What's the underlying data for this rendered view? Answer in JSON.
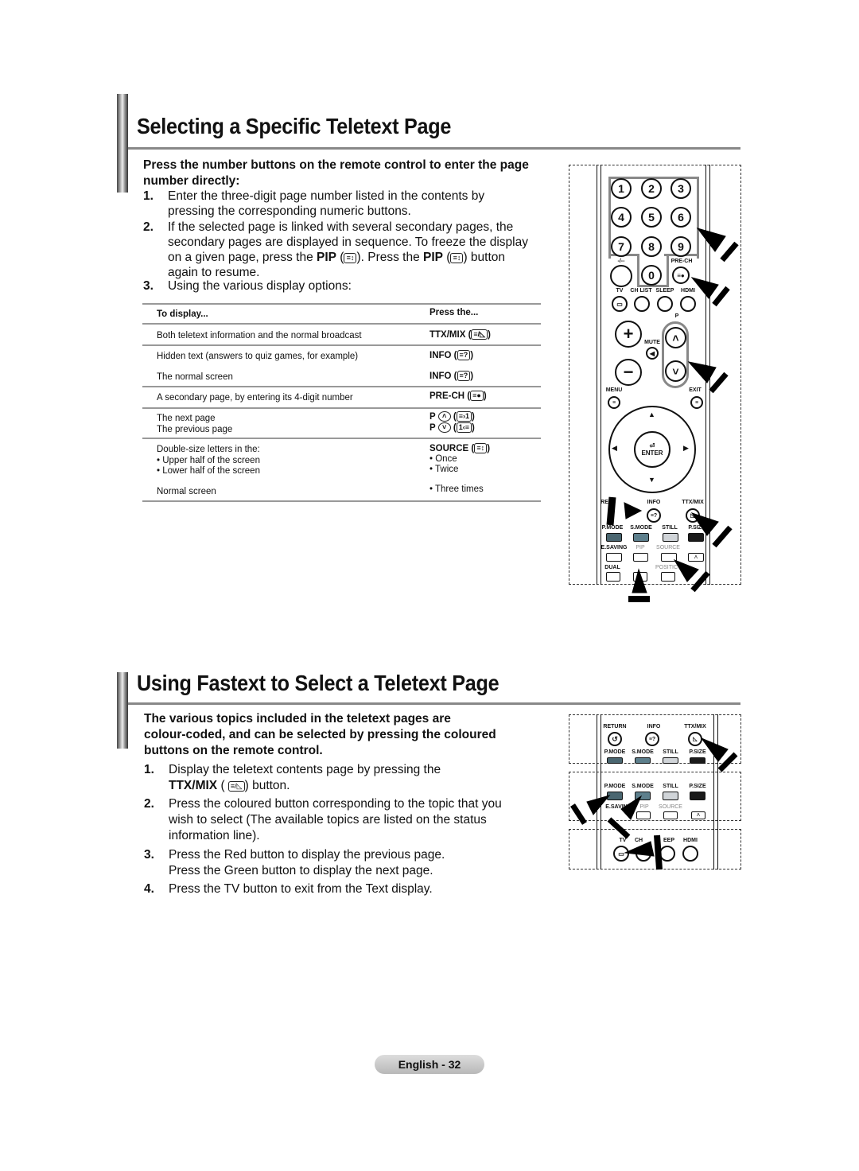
{
  "section1": {
    "title": "Selecting a Specific Teletext Page",
    "intro_line1": "Press the number buttons on the remote control to enter the page",
    "intro_line2": "number directly:",
    "steps": [
      {
        "num": "1.",
        "lines": [
          "Enter the three-digit page number listed in the contents by",
          "pressing the corresponding numeric buttons."
        ]
      },
      {
        "num": "2.",
        "lines": [
          "If the selected page is linked with several secondary pages, the",
          "secondary pages are displayed in sequence. To freeze the display",
          "again to resume."
        ],
        "pip_line": {
          "a": "on a given page, press the ",
          "pip": "PIP",
          "b": "). Press the ",
          "c": ") button"
        }
      },
      {
        "num": "3.",
        "lines": [
          "Using the various display options:"
        ]
      }
    ],
    "table": {
      "headers": [
        "To display...",
        "Press the..."
      ],
      "rows": [
        {
          "display": "Both teletext information and the normal broadcast",
          "press": "TTX/MIX",
          "icon": "ttx-mix-icon"
        },
        {
          "display": "Hidden text (answers to quiz games, for example)",
          "press": "INFO",
          "icon": "info-reveal-icon"
        },
        {
          "display": "The normal screen",
          "press": "INFO",
          "icon": "info-reveal-icon"
        },
        {
          "display": "A secondary page, by entering its 4-digit number",
          "press": "PRE-CH",
          "icon": "subpage-icon"
        },
        {
          "display": "The next page",
          "press": "P",
          "icon": "page-up-icon"
        },
        {
          "display": "The previous page",
          "press": "P",
          "icon": "page-down-icon"
        },
        {
          "display": "Double-size letters in the:",
          "press": "SOURCE",
          "icon": "size-icon"
        },
        {
          "display": "• Upper half of the screen",
          "press": "• Once"
        },
        {
          "display": "• Lower half of the screen",
          "press": "• Twice"
        },
        {
          "display": "Normal screen",
          "press": "• Three times"
        }
      ]
    }
  },
  "remote1": {
    "numbers": [
      "1",
      "2",
      "3",
      "4",
      "5",
      "6",
      "7",
      "8",
      "9",
      "0"
    ],
    "labels": {
      "dash": "-/--",
      "prech": "PRE-CH",
      "tv": "TV",
      "chlist": "CH LIST",
      "sleep": "SLEEP",
      "hdmi": "HDMI",
      "p": "P",
      "mute": "MUTE",
      "menu": "MENU",
      "exit": "EXIT",
      "enter": "ENTER",
      "return": "RE",
      "info": "INFO",
      "ttx": "TTX/MIX",
      "pmode": "P.MODE",
      "smode": "S.MODE",
      "still": "STILL",
      "psize": "P.SIZE",
      "esaving": "E.SAVING",
      "pip": "PIP",
      "source": "SOURCE",
      "dual": "DUAL",
      "position": "POSITIC"
    },
    "colors": {
      "red": "#4a6670",
      "green": "#5d7f8c",
      "yellow": "#d0d4d8",
      "blue": "#1a1a1a"
    }
  },
  "section2": {
    "title": "Using Fastext to Select a Teletext Page",
    "intro": [
      "The various topics included in the teletext pages are",
      "colour-coded, and can be selected by pressing the coloured",
      "buttons on the remote control."
    ],
    "steps": [
      {
        "num": "1.",
        "lines": [
          "Display the teletext contents page by pressing the"
        ],
        "ttx": "TTX/MIX",
        "ttx_after": ") button."
      },
      {
        "num": "2.",
        "lines": [
          "Press the coloured button corresponding to the topic that you",
          "wish to select (The available topics are listed on the status",
          "information line)."
        ]
      },
      {
        "num": "3.",
        "lines": [
          "Press the Red button to display the previous page.",
          "Press the Green button to display the next page."
        ]
      },
      {
        "num": "4.",
        "lines_pre": "Press the ",
        "tv": "TV",
        "lines_post": " button to exit from the Text display."
      }
    ]
  },
  "remote2": {
    "labels": {
      "return": "RETURN",
      "info": "INFO",
      "ttx": "TTX/MIX",
      "pmode": "P.MODE",
      "smode": "S.MODE",
      "still": "STILL",
      "psize": "P.SIZE",
      "esaving": "E.SAVIN",
      "pip": "PIP",
      "source": "SOURCE",
      "tv": "TV",
      "ch": "CH",
      "sleep": "EEP",
      "hdmi": "HDMI"
    }
  },
  "footer": {
    "page": "English - 32"
  }
}
